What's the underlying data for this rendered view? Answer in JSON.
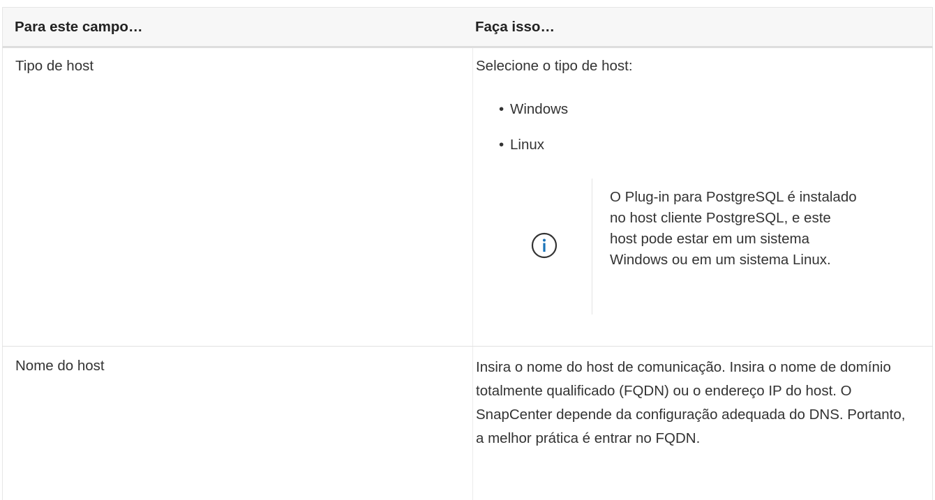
{
  "table": {
    "header": {
      "col1": "Para este campo…",
      "col2": "Faça isso…"
    },
    "rows": [
      {
        "field": "Tipo de host",
        "action_intro": "Selecione o tipo de host:",
        "options": [
          "Windows",
          "Linux"
        ],
        "note": {
          "icon": "info-icon",
          "text": "O Plug-in para PostgreSQL é instalado no host cliente PostgreSQL, e este host pode estar em um sistema Windows ou em um sistema Linux."
        }
      },
      {
        "field": "Nome do host",
        "action": "Insira o nome do host de comunicação. Insira o nome de domínio totalmente qualificado (FQDN) ou o endereço IP do host. O SnapCenter depende da configuração adequada do DNS. Portanto, a melhor prática é entrar no FQDN."
      }
    ]
  },
  "colors": {
    "info_icon": "#1a73b8",
    "header_bg": "#f7f7f7",
    "border": "#dddddd"
  }
}
